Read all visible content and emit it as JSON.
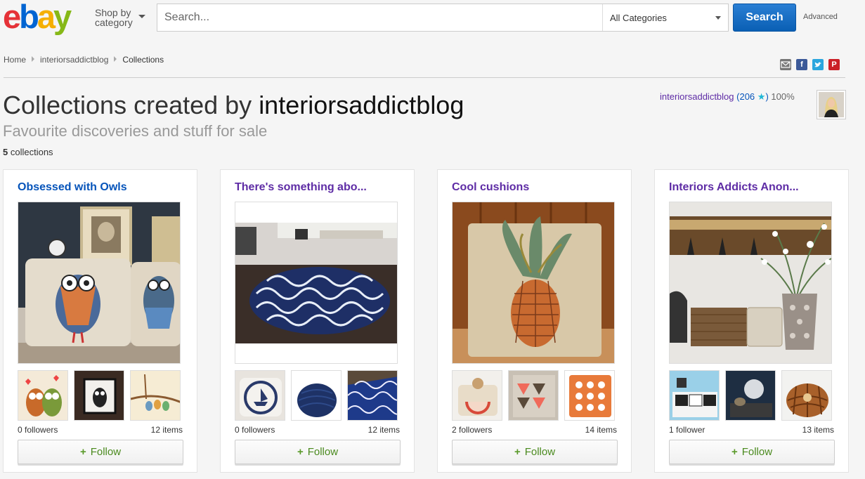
{
  "header": {
    "logo": "ebay",
    "shop_by_line1": "Shop by",
    "shop_by_line2": "category",
    "search_placeholder": "Search...",
    "category_select": "All Categories",
    "search_button": "Search",
    "advanced_link": "Advanced"
  },
  "breadcrumb": {
    "home": "Home",
    "user": "interiorsaddictblog",
    "current": "Collections"
  },
  "share_icons": [
    "email-icon",
    "facebook-icon",
    "twitter-icon",
    "pinterest-icon"
  ],
  "page": {
    "title_prefix": "Collections created by ",
    "title_user": "interiorsaddictblog",
    "subtitle": "Favourite discoveries and stuff for sale",
    "collection_count": "5",
    "collection_count_label": " collections"
  },
  "seller": {
    "name": "interiorsaddictblog",
    "open_paren": " (",
    "score": "206",
    "star": " ★",
    "close_paren": ")",
    "percent": " 100%"
  },
  "collections": [
    {
      "title": "Obsessed with Owls",
      "followers": "0 followers",
      "items": "12 items",
      "follow_label": "Follow"
    },
    {
      "title": "There's something abo...",
      "followers": "0 followers",
      "items": "12 items",
      "follow_label": "Follow"
    },
    {
      "title": "Cool cushions",
      "followers": "2 followers",
      "items": "14 items",
      "follow_label": "Follow"
    },
    {
      "title": "Interiors Addicts Anon...",
      "followers": "1 follower",
      "items": "13 items",
      "follow_label": "Follow"
    }
  ],
  "colors": {
    "brand_blue": "#0654ba",
    "link_purple": "#5e2ca5",
    "follow_green": "#4a8a1e",
    "search_button": "#0a5fb4"
  }
}
